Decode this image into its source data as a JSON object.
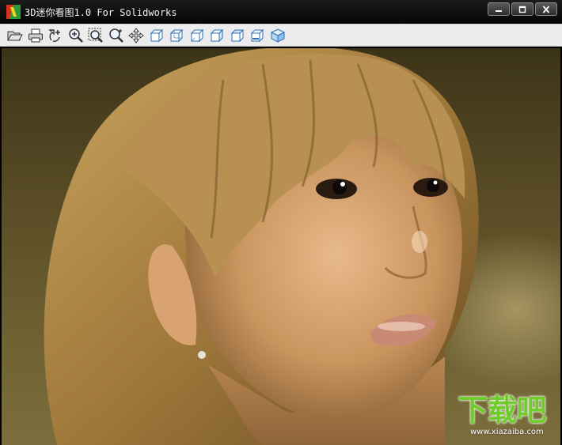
{
  "window": {
    "title": "3D迷你看图1.0 For Solidworks",
    "controls": [
      {
        "name": "minimize"
      },
      {
        "name": "maximize"
      },
      {
        "name": "close"
      }
    ]
  },
  "toolbar": {
    "buttons": [
      {
        "name": "open-icon"
      },
      {
        "name": "print-icon"
      },
      {
        "name": "rotate-icon"
      },
      {
        "name": "zoom-in-icon"
      },
      {
        "name": "zoom-fit-icon"
      },
      {
        "name": "zoom-icon"
      },
      {
        "name": "pan-icon"
      },
      {
        "name": "view-front-icon"
      },
      {
        "name": "view-back-icon"
      },
      {
        "name": "view-left-icon"
      },
      {
        "name": "view-right-icon"
      },
      {
        "name": "view-top-icon"
      },
      {
        "name": "view-bottom-icon"
      },
      {
        "name": "view-isometric-icon"
      }
    ]
  },
  "viewport": {
    "content": "photo"
  },
  "watermark": {
    "logo_text": "下载吧",
    "url": "www.xiazaiba.com"
  },
  "colors": {
    "titlebar": "#111111",
    "toolbar": "#ececec",
    "accent": "#2a6fb8",
    "watermark_green": "#6fcc2a"
  }
}
